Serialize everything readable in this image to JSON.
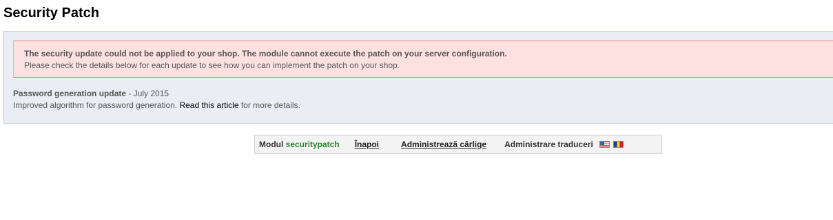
{
  "page": {
    "title": "Security Patch"
  },
  "alert": {
    "title": "The security update could not be applied to your shop. The module cannot execute the patch on your server configuration.",
    "detail": "Please check the details below for each update to see how you can implement the patch on your shop."
  },
  "update": {
    "name": "Password generation update",
    "date": " - July 2015",
    "description_before": "Improved algorithm for password generation. ",
    "link_label": "Read this article",
    "description_after": " for more details."
  },
  "toolbar": {
    "module_prefix": "Modul ",
    "module_name": "securitypatch",
    "back_label": "Înapoi",
    "hooks_label": "Administrează cârlige",
    "translations_label": "Administrare traduceri",
    "flags": [
      "us-flag-icon",
      "ro-flag-icon"
    ]
  },
  "colors": {
    "alert_background": "#fde1e1",
    "alert_border": "#e07f7f",
    "panel_background": "#ebedf4",
    "module_name": "#2a8a2a"
  }
}
